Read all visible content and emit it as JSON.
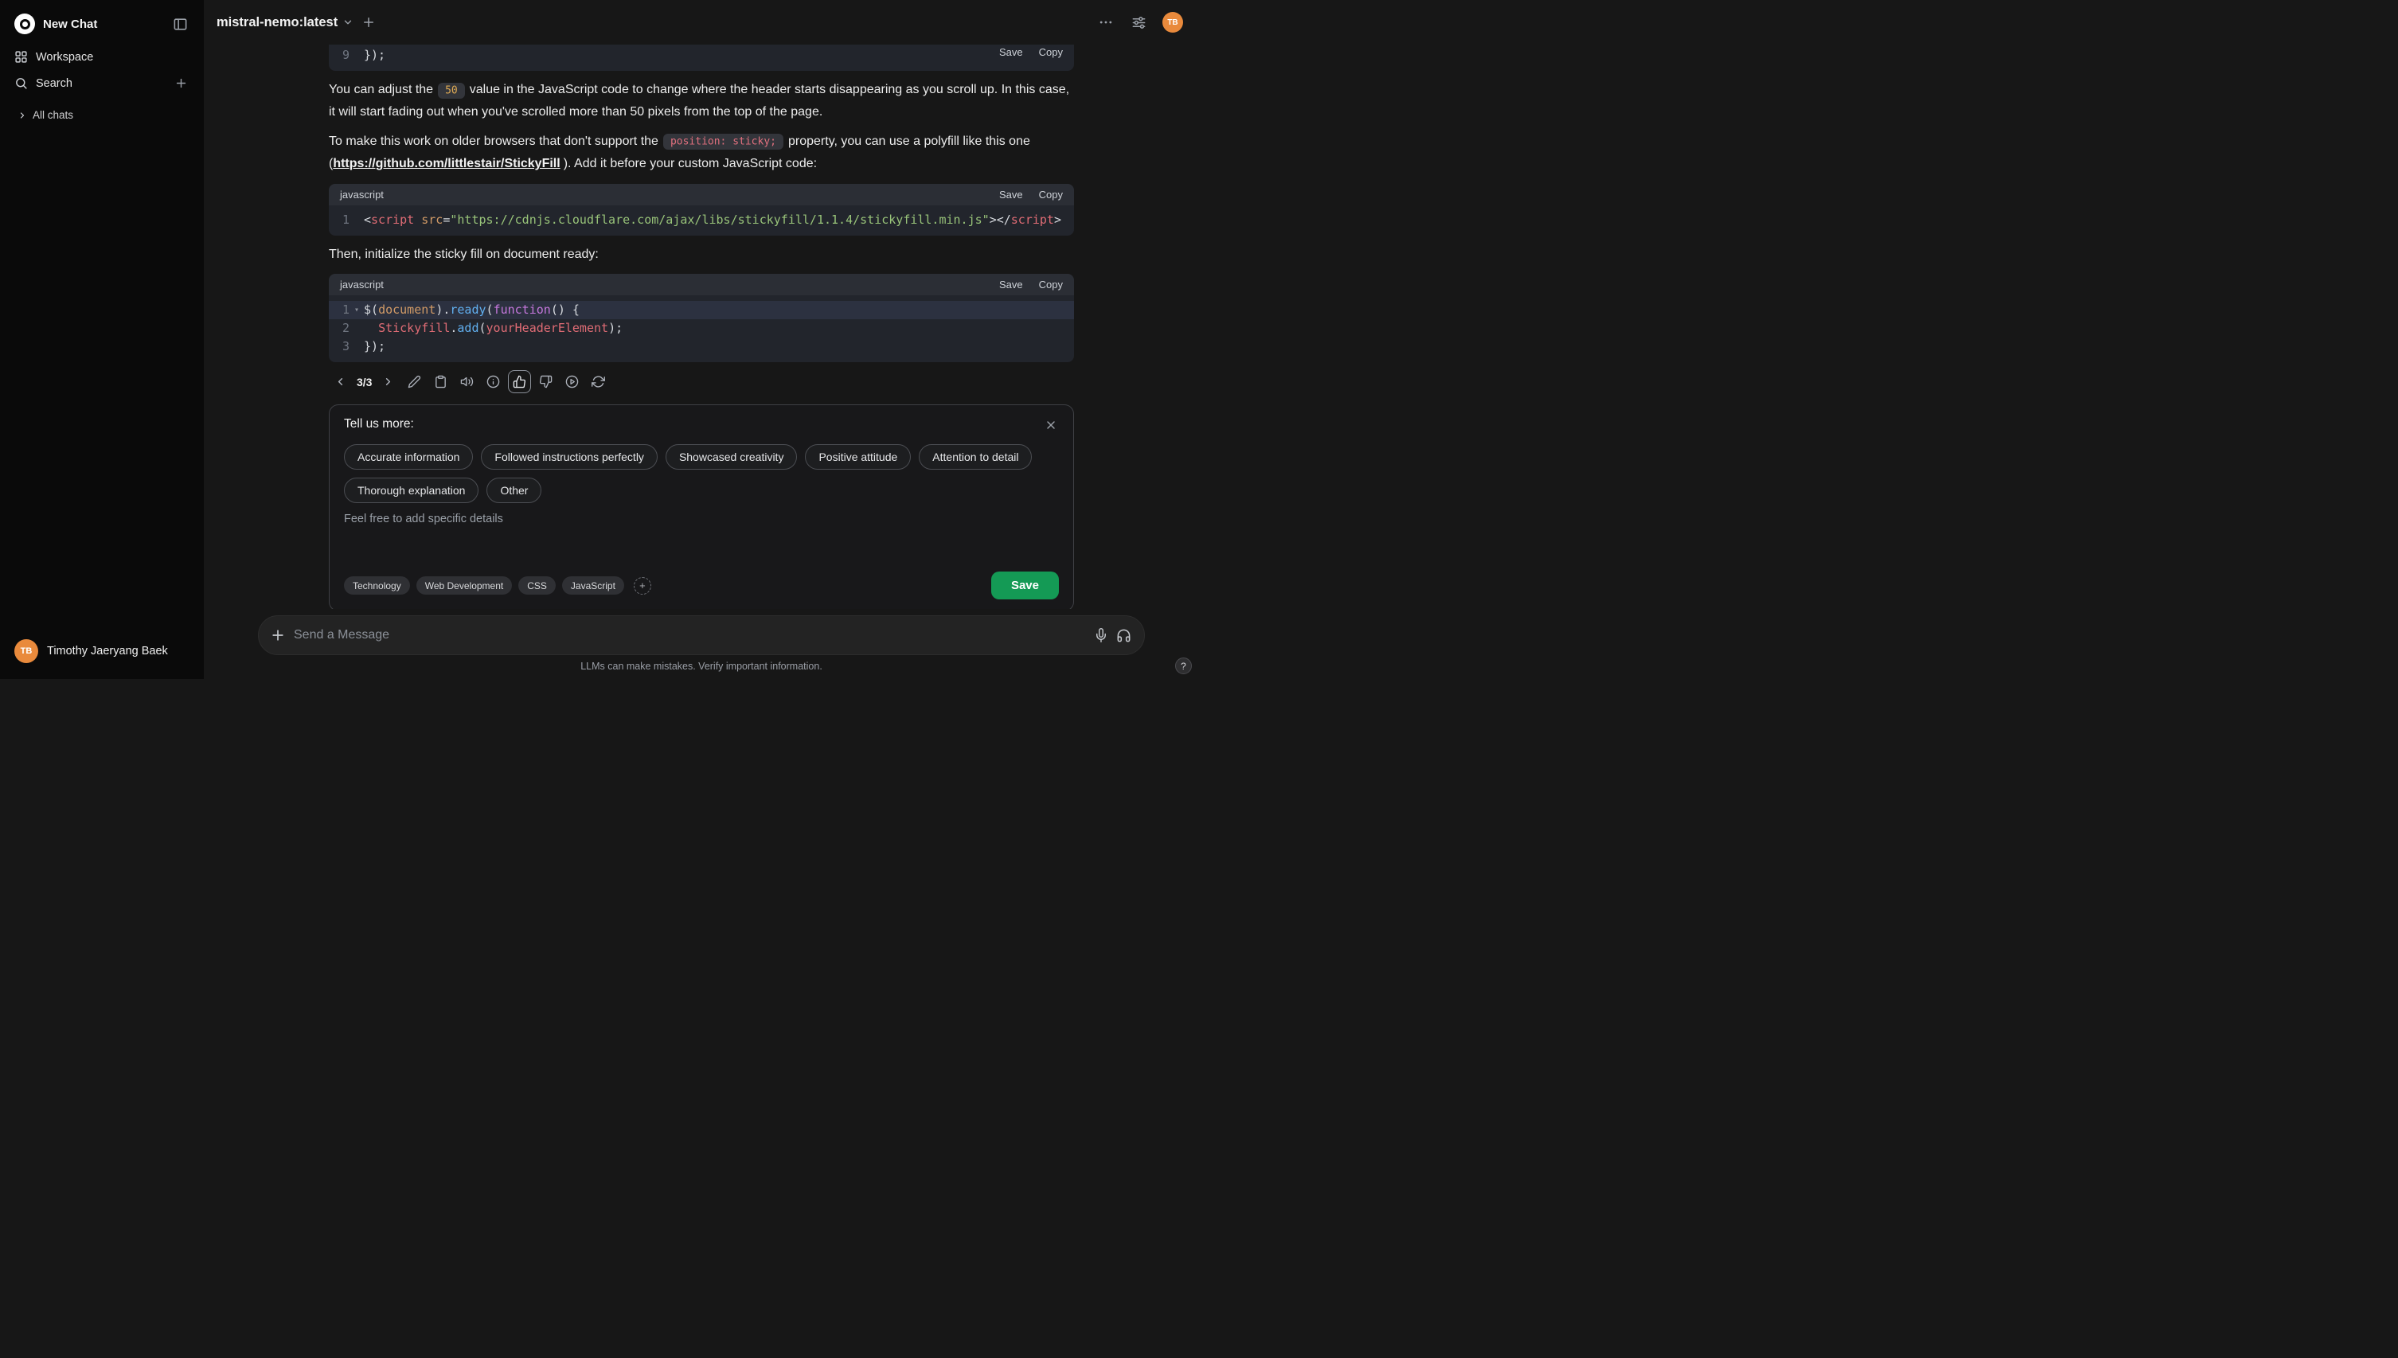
{
  "icons": {
    "fold_chevron": "▾",
    "help": "?",
    "plus": "+"
  },
  "colors": {
    "accent_green": "#149a55",
    "avatar_orange": "#e98a3c",
    "sidebar_bg": "#0a0a0a",
    "main_bg": "#171717"
  },
  "sidebar": {
    "new_chat_label": "New Chat",
    "workspace_label": "Workspace",
    "search_label": "Search",
    "all_chats_label": "All chats",
    "user_name": "Timothy Jaeryang Baek",
    "user_initials": "TB"
  },
  "header": {
    "model_name": "mistral-nemo:latest",
    "avatar_initials": "TB"
  },
  "message": {
    "partial": {
      "save_label": "Save",
      "copy_label": "Copy",
      "lines": [
        {
          "n": "9",
          "tokens": [
            {
              "t": "});",
              "c": "p"
            }
          ]
        }
      ]
    },
    "para1": {
      "pre": "You can adjust the",
      "code": "50",
      "post": "value in the JavaScript code to change where the header starts disappearing as you scroll up. In this case, it will start fading out when you've scrolled more than 50 pixels from the top of the page."
    },
    "para2": {
      "pre": "To make this work on older browsers that don't support the",
      "code": "position: sticky;",
      "mid": "property, you can use a polyfill like this one (",
      "link": "https://github.com/littlestair/StickyFill",
      "post": "). Add it before your custom JavaScript code:"
    },
    "code1": {
      "lang": "javascript",
      "save_label": "Save",
      "copy_label": "Copy",
      "lines": [
        {
          "n": "1",
          "tokens": [
            {
              "t": "<",
              "c": "p"
            },
            {
              "t": "script",
              "c": "red"
            },
            {
              "t": " ",
              "c": "p"
            },
            {
              "t": "src",
              "c": "orange"
            },
            {
              "t": "=",
              "c": "p"
            },
            {
              "t": "\"https://cdnjs.cloudflare.com/ajax/libs/stickyfill/1.1.4/stickyfill.min.js\"",
              "c": "green"
            },
            {
              "t": "></",
              "c": "p"
            },
            {
              "t": "script",
              "c": "red"
            },
            {
              "t": ">",
              "c": "p"
            }
          ]
        }
      ]
    },
    "para3": "Then, initialize the sticky fill on document ready:",
    "code2": {
      "lang": "javascript",
      "save_label": "Save",
      "copy_label": "Copy",
      "lines": [
        {
          "n": "1",
          "fold": true,
          "hl": true,
          "tokens": [
            {
              "t": "$(",
              "c": "p"
            },
            {
              "t": "document",
              "c": "orange"
            },
            {
              "t": ").",
              "c": "p"
            },
            {
              "t": "ready",
              "c": "blue"
            },
            {
              "t": "(",
              "c": "p"
            },
            {
              "t": "function",
              "c": "purple"
            },
            {
              "t": "() {",
              "c": "p"
            }
          ]
        },
        {
          "n": "2",
          "tokens": [
            {
              "t": "  ",
              "c": "p"
            },
            {
              "t": "Stickyfill",
              "c": "red"
            },
            {
              "t": ".",
              "c": "p"
            },
            {
              "t": "add",
              "c": "blue"
            },
            {
              "t": "(",
              "c": "p"
            },
            {
              "t": "yourHeaderElement",
              "c": "red"
            },
            {
              "t": ");",
              "c": "p"
            }
          ]
        },
        {
          "n": "3",
          "tokens": [
            {
              "t": "});",
              "c": "p"
            }
          ]
        }
      ]
    },
    "pager": "3/3"
  },
  "feedback": {
    "title": "Tell us more:",
    "options": [
      "Accurate information",
      "Followed instructions perfectly",
      "Showcased creativity",
      "Positive attitude",
      "Attention to detail",
      "Thorough explanation",
      "Other"
    ],
    "placeholder": "Feel free to add specific details",
    "tags": [
      "Technology",
      "Web Development",
      "CSS",
      "JavaScript"
    ],
    "save_label": "Save"
  },
  "composer": {
    "placeholder": "Send a Message"
  },
  "footer": {
    "disclaimer": "LLMs can make mistakes. Verify important information."
  }
}
